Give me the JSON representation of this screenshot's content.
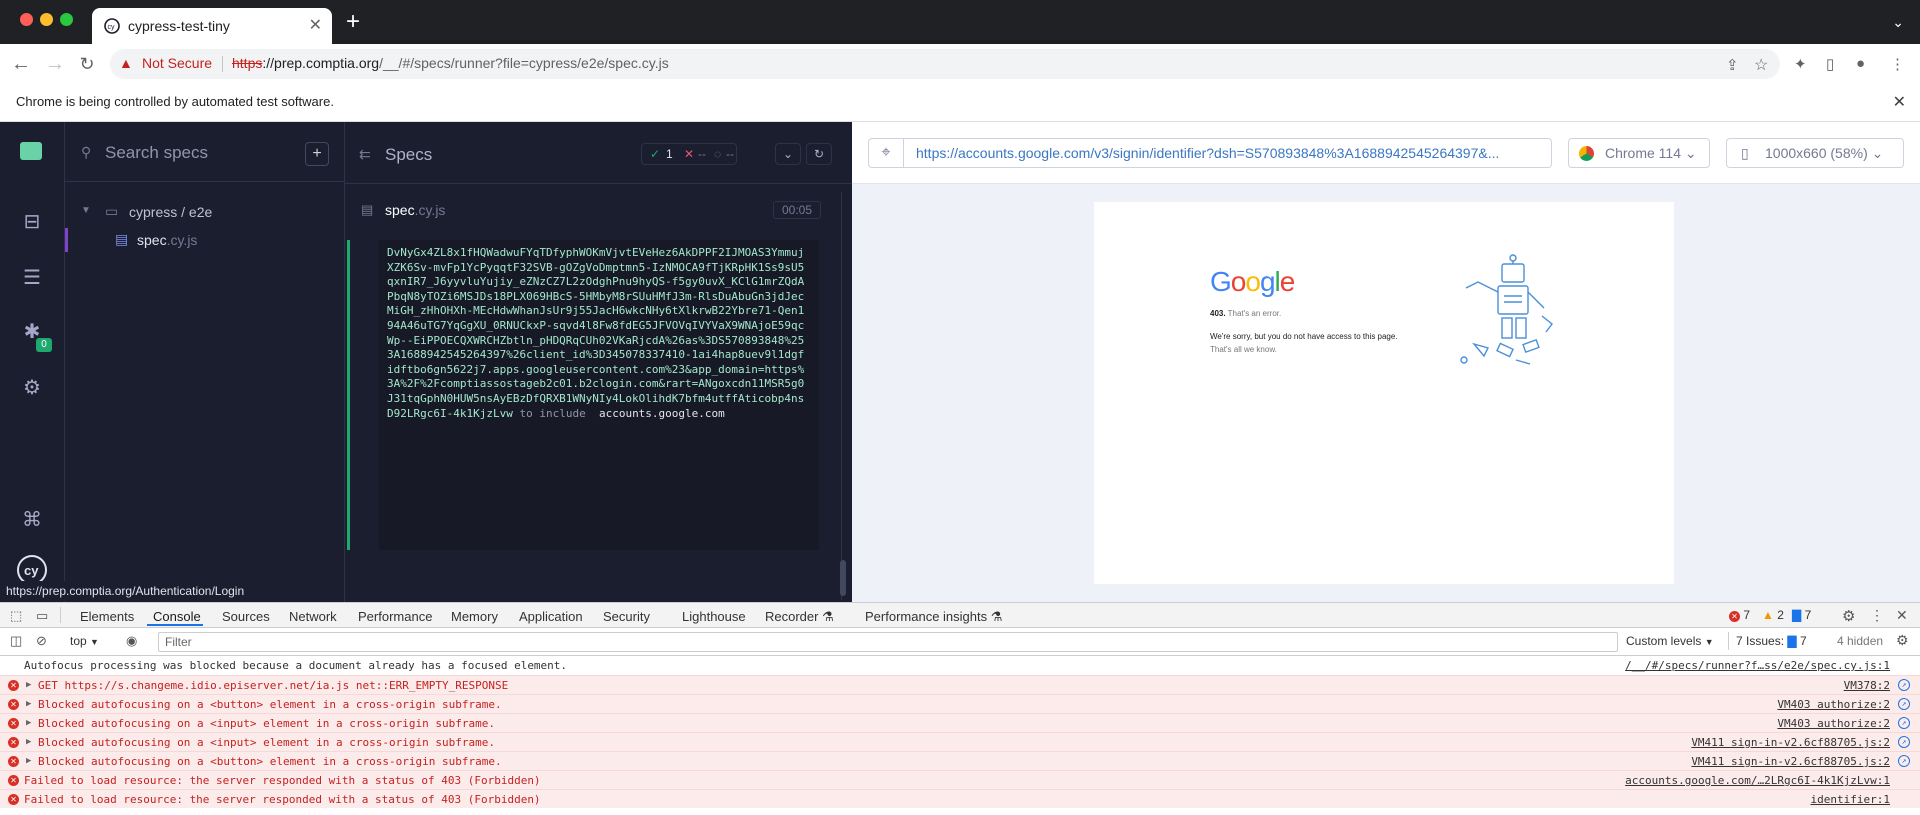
{
  "browser": {
    "tab_title": "cypress-test-tiny",
    "new_tab": "+",
    "security_label": "Not Secure",
    "url_scheme": "https",
    "url_host": "://prep.comptia.org",
    "url_path": "/__/#/specs/runner?file=cypress/e2e/spec.cy.js",
    "infobar_message": "Chrome is being controlled by automated test software."
  },
  "specs_panel": {
    "search_placeholder": "Search specs",
    "add_button": "+",
    "folder": "cypress / e2e",
    "spec_name": "spec",
    "spec_ext": ".cy.js"
  },
  "nav": {
    "debug_badge": "0"
  },
  "runner": {
    "header_label": "Specs",
    "passed": "1",
    "failed": "--",
    "pending": "--",
    "spec_name": "spec",
    "spec_ext": ".cy.js",
    "duration": "00:05",
    "log_text": "DvNyGx4ZL8x1fHQWadwuFYqTDfyphWOKmVjvtEVeHez6AkDPPF2IJMOAS3YmmujXZK6Sv-mvFp1YcPyqqtF32SVB-gOZgVoDmptmn5-IzNMOCA9fTjKRpHK1Ss9sU5qxnIR7_J6yyvluYujiy_eZNzCZ7L2zOdghPnu9hyQS-f5gy0uvX_KClG1mrZQdAPbqN8yTOZi6MSJDs18PLX069HBcS-5HMbyM8rSUuHMfJ3m-RlsDuAbuGn3jdJecMiGH_zHhOHXh-MEcHdwWhanJsUr9j55JacH6wkcNHy6tXlkrwB22Ybre71-Qen194A46uTG7YqGgXU_0RNUCkxP-sqvd4l8Fw8fdEG5JFVOVqIVYVaX9WNAjoE59qcWp--EiPPOECQXWRCHZbtln_pHDQRqCUh02VKaRjcdA%26as%3DS570893848%253A1688942545264397%26client_id%3D345078337410-1ai4hap8uev9l1dgfidftbo6gn5622j7.apps.googleusercontent.com%23&app_domain=https%3A%2F%2Fcomptiassostageb2c01.b2clogin.com&rart=ANgoxcdn11MSR5g0J31tqGphN0HUW5nsAyEBzDfQRXB1WNyNIy4LokOlihdK7bfm4utffAticobp4nsD92LRgc6I-4k1KjzLvw",
    "log_keyword": " to include ",
    "log_string": " accounts.google.com"
  },
  "aut": {
    "url": "https://accounts.google.com/v3/signin/identifier?dsh=S570893848%3A1688942545264397&...",
    "browser": "Chrome 114",
    "viewport": "1000x660 (58%)",
    "page": {
      "logo": "Google",
      "code": "403.",
      "error": "That's an error.",
      "msg1": "We're sorry, but you do not have access to this page.",
      "msg2": "That's all we know."
    }
  },
  "status_url": "https://prep.comptia.org/Authentication/Login",
  "devtools": {
    "tabs": [
      "Elements",
      "Console",
      "Sources",
      "Network",
      "Performance",
      "Memory",
      "Application",
      "Security",
      "Lighthouse",
      "Recorder",
      "Performance insights"
    ],
    "errors": "7",
    "warnings": "2",
    "messages": "7",
    "context": "top",
    "filter_placeholder": "Filter",
    "levels": "Custom levels",
    "issues_label": "7 Issues:",
    "issues_count": "7",
    "hidden": "4 hidden",
    "rows": [
      {
        "type": "info",
        "msg": "Autofocus processing was blocked because a document already has a focused element.",
        "src": "/__/#/specs/runner?f…ss/e2e/spec.cy.js:1"
      },
      {
        "type": "error",
        "caret": true,
        "msg": "GET https://s.changeme.idio.episerver.net/ia.js net::ERR_EMPTY_RESPONSE",
        "src": "VM378:2"
      },
      {
        "type": "error",
        "caret": true,
        "msg": "Blocked autofocusing on a <button> element in a cross-origin subframe.",
        "src": "VM403 authorize:2"
      },
      {
        "type": "error",
        "caret": true,
        "msg": "Blocked autofocusing on a <input> element in a cross-origin subframe.",
        "src": "VM403 authorize:2"
      },
      {
        "type": "error",
        "caret": true,
        "msg": "Blocked autofocusing on a <input> element in a cross-origin subframe.",
        "src": "VM411 sign-in-v2.6cf88705.js:2"
      },
      {
        "type": "error",
        "caret": true,
        "msg": "Blocked autofocusing on a <button> element in a cross-origin subframe.",
        "src": "VM411 sign-in-v2.6cf88705.js:2"
      },
      {
        "type": "error",
        "caret": false,
        "msg": "Failed to load resource: the server responded with a status of 403 (Forbidden)",
        "src": "accounts.google.com/…2LRgc6I-4k1KjzLvw:1"
      },
      {
        "type": "error",
        "caret": false,
        "msg": "Failed to load resource: the server responded with a status of 403 (Forbidden)",
        "src": "identifier:1"
      }
    ]
  }
}
